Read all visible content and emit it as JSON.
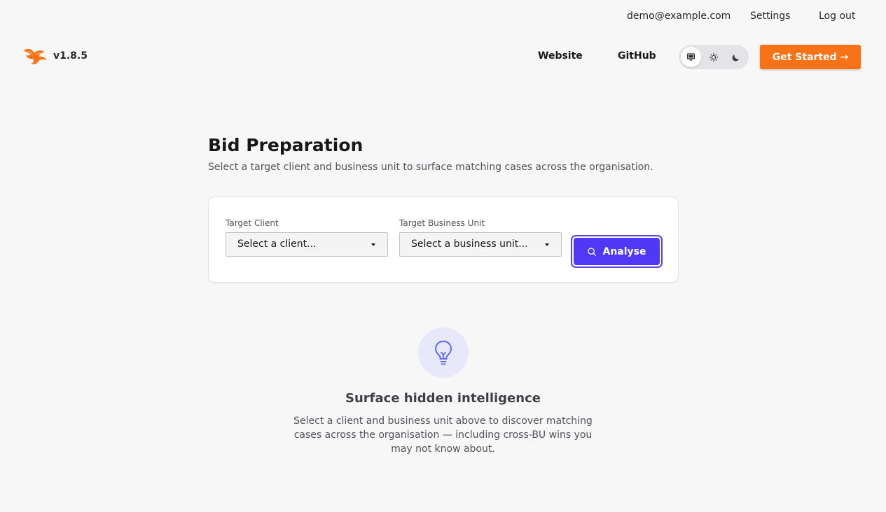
{
  "topbar": {
    "email": "demo@example.com",
    "settings": "Settings",
    "logout": "Log out"
  },
  "navbar": {
    "logo_icon": "phoenix-logo-icon",
    "version": "v1.8.5",
    "website": "Website",
    "github": "GitHub",
    "theme_options": [
      "system",
      "light",
      "dark"
    ],
    "theme_selected": "system",
    "get_started": "Get Started →"
  },
  "main": {
    "title": "Bid Preparation",
    "subtitle": "Select a target client and business unit to surface matching cases across the organisation.",
    "form": {
      "client_label": "Target Client",
      "client_value": "Select a client...",
      "bu_label": "Target Business Unit",
      "bu_value": "Select a business unit...",
      "analyse": "Analyse"
    },
    "empty_state": {
      "icon": "lightbulb-icon",
      "title": "Surface hidden intelligence",
      "description": "Select a client and business unit above to discover matching cases across the organisation — including cross-BU wins you may not know about."
    }
  },
  "colors": {
    "accent": "#f97316",
    "primary": "#4f39f6",
    "background": "#f7f7f7"
  }
}
